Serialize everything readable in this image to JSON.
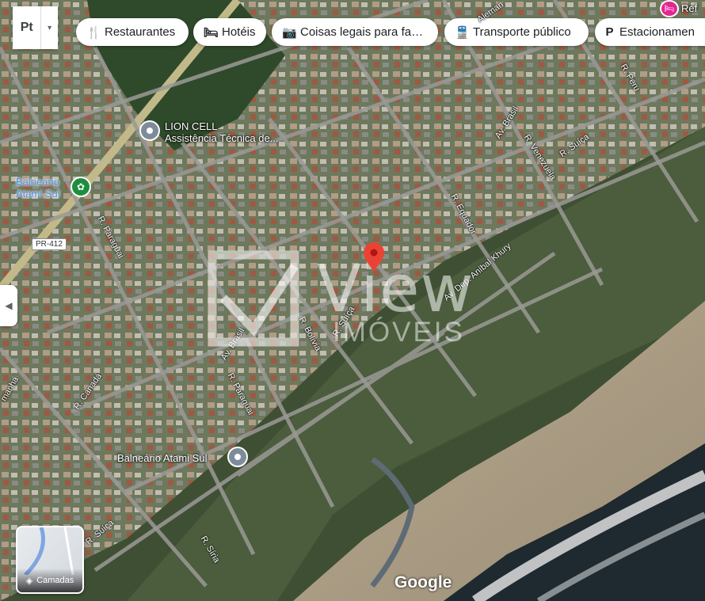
{
  "map_type_button": {
    "label": "Pt",
    "caret": "▾"
  },
  "chips": [
    {
      "label": "Restaurantes",
      "icon": "🍴"
    },
    {
      "label": "Hotéis",
      "icon": "🛏"
    },
    {
      "label": "Coisas legais para fa…",
      "icon": "📷"
    },
    {
      "label": "Transporte público",
      "icon": "🚆"
    },
    {
      "label": "Estacionamen",
      "icon": "P"
    }
  ],
  "top_right_label": "Ref",
  "places": {
    "lion_cell_name": "LION CELL",
    "lion_cell_sub": "Assistência Técnica de...",
    "balneario_park": "Balneário\nAtami Sul",
    "balneario_pin": "Balneário Atami Sul"
  },
  "road_shield": "PR-412",
  "streets": {
    "paraguai_1": "R. Paraguai",
    "paraguai_2": "R. Paraguai",
    "brasil_1": "Av. Brasil",
    "brasil_2": "Av. Brasil",
    "bolivia": "R. Bolívia",
    "suica_1": "R. Suíça",
    "suica_2": "R. Suíça",
    "suica_3": "R. Suíça",
    "equador": "R. Equador",
    "venezuela": "R. Venezuela",
    "peru": "R. Peru",
    "alemanha": "Alemanha",
    "anibal": "Av. Dep. Aníbal Khury",
    "canada": "R. Canadá",
    "siria": "R. Síria",
    "manha": "manha",
    "aleman_top": "Aleman"
  },
  "watermark": {
    "main": "View",
    "sub": "IMÓVEIS"
  },
  "layers_label": "Camadas",
  "google_logo": "Google",
  "colors": {
    "pin": "#ea4335",
    "poi": "#7d8b9a",
    "park_poi": "#1e8e3e",
    "hotel": "#e52592"
  }
}
